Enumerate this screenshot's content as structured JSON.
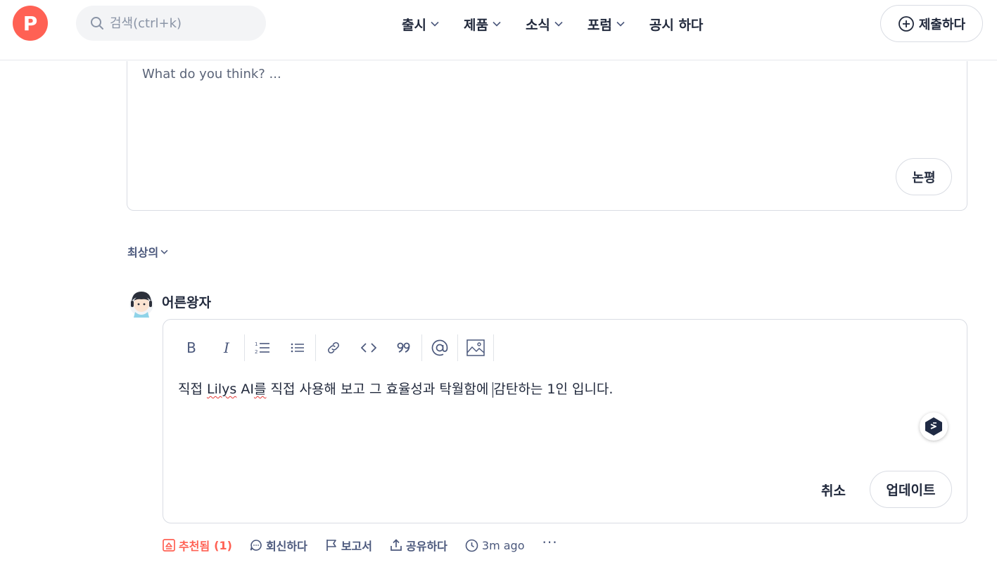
{
  "header": {
    "logo_letter": "P",
    "search_placeholder": "검색(ctrl+k)",
    "nav": [
      {
        "label": "출시"
      },
      {
        "label": "제품"
      },
      {
        "label": "소식"
      },
      {
        "label": "포럼"
      },
      {
        "label": "공시 하다"
      }
    ],
    "submit_label": "제출하다",
    "brand_color": "#ff6154"
  },
  "comment_box": {
    "placeholder": "What do you think? ...",
    "button_label": "논평"
  },
  "sort": {
    "label": "최상의"
  },
  "comment": {
    "username": "어른왕자",
    "text_before_caret_1": "직접 ",
    "spell_1": "Lilys",
    "text_mid_1": " AI",
    "spell_2": "를",
    "text_mid_2": " 직접 사용해 보고 그 효율성과 탁월함에 ",
    "text_after_caret": "감탄하는 1인 입니다.",
    "cancel_label": "취소",
    "update_label": "업데이트"
  },
  "toolbar": {
    "bold": "B",
    "italic": "I"
  },
  "actions": {
    "upvote_label": "추천됨",
    "upvote_count": "(1)",
    "reply_label": "회신하다",
    "report_label": "보고서",
    "share_label": "공유하다",
    "time_label": "3m ago",
    "more_label": "···"
  }
}
